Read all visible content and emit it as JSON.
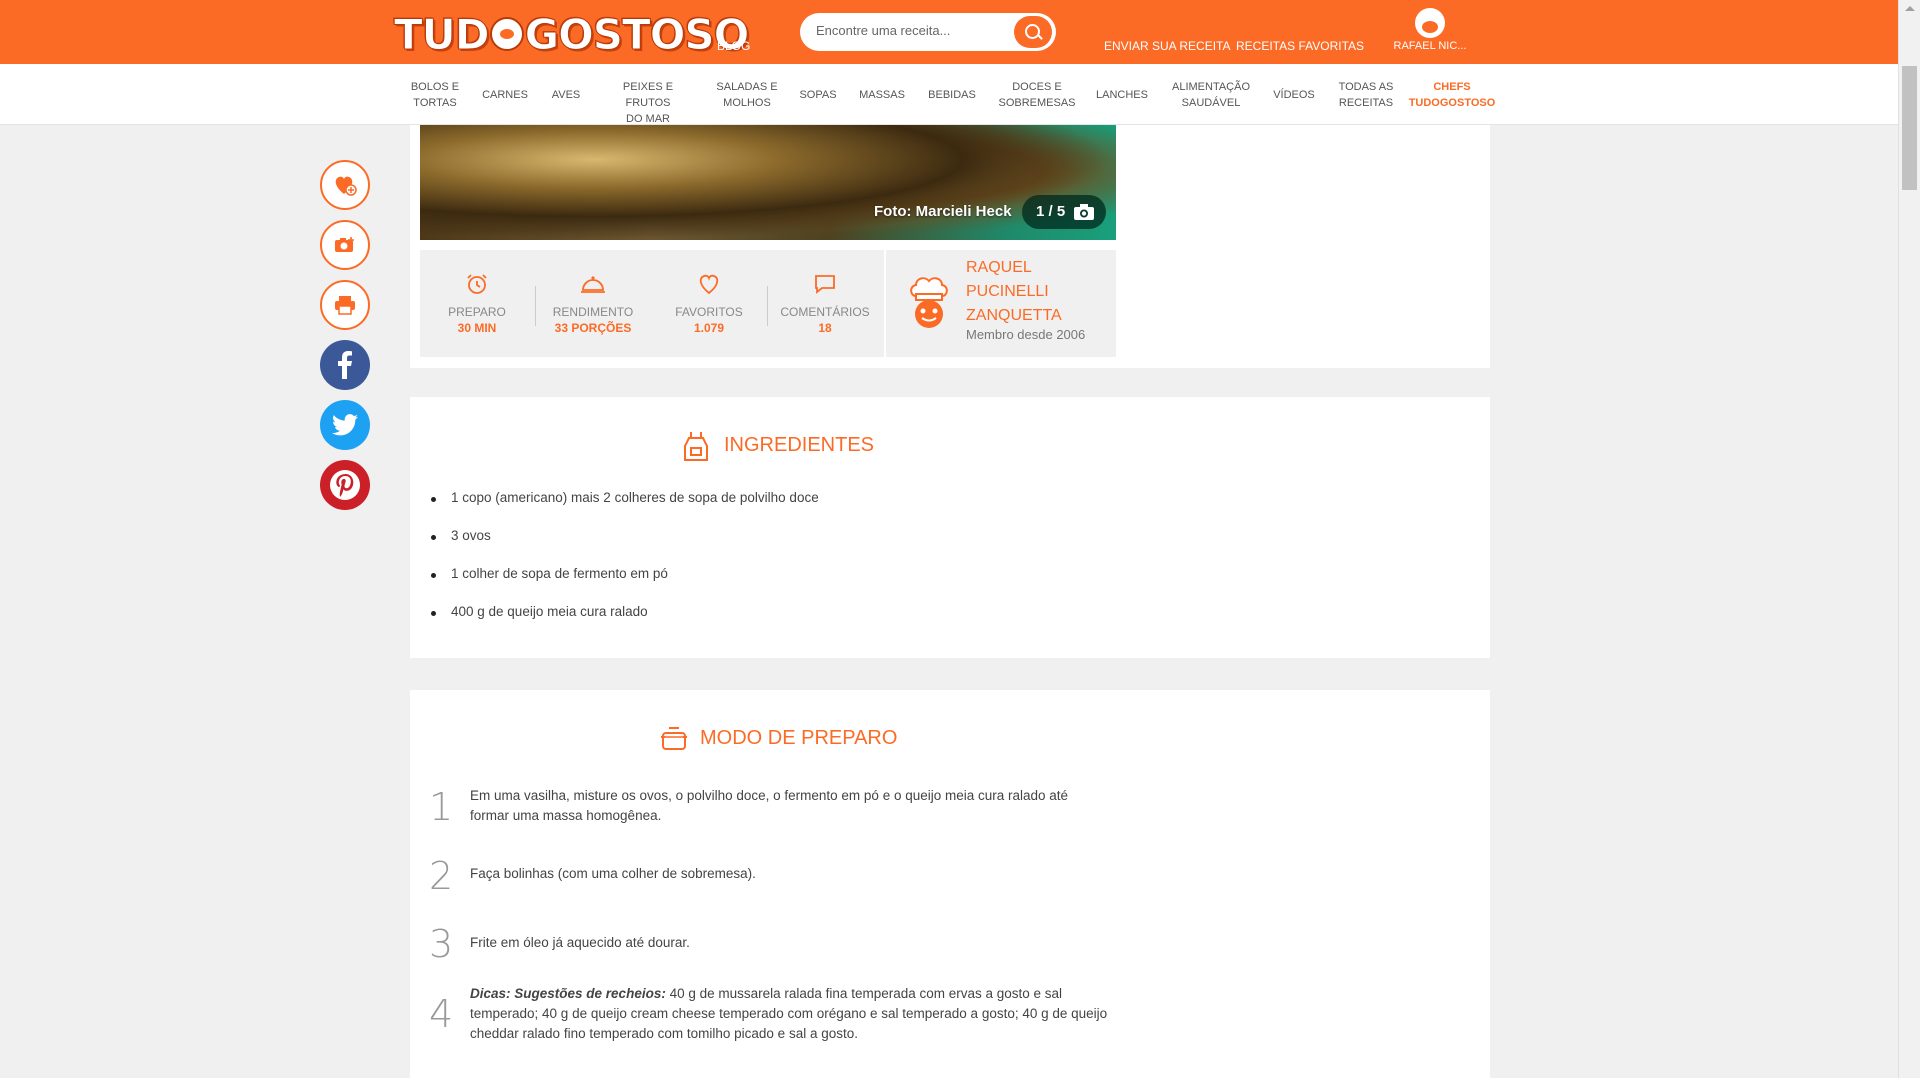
{
  "header": {
    "logo_text": "TUDOGOSTOSO",
    "blog_label": "BLOG",
    "search_placeholder": "Encontre uma receita...",
    "send_recipe": "ENVIAR SUA RECEITA",
    "favorites": "RECEITAS FAVORITAS",
    "user_name": "RAFAEL NIC..."
  },
  "categories": [
    {
      "label1": "BOLOS E",
      "label2": "TORTAS"
    },
    {
      "label1": "CARNES",
      "label2": ""
    },
    {
      "label1": "AVES",
      "label2": ""
    },
    {
      "label1": "PEIXES E FRUTOS",
      "label2": "DO MAR"
    },
    {
      "label1": "SALADAS E",
      "label2": "MOLHOS"
    },
    {
      "label1": "SOPAS",
      "label2": ""
    },
    {
      "label1": "MASSAS",
      "label2": ""
    },
    {
      "label1": "BEBIDAS",
      "label2": ""
    },
    {
      "label1": "DOCES E",
      "label2": "SOBREMESAS"
    },
    {
      "label1": "LANCHES",
      "label2": ""
    },
    {
      "label1": "ALIMENTAÇÃO",
      "label2": "SAUDÁVEL"
    },
    {
      "label1": "VÍDEOS",
      "label2": ""
    },
    {
      "label1": "TODAS AS",
      "label2": "RECEITAS"
    },
    {
      "label1": "CHEFS",
      "label2": "TUDOGOSTOSO"
    }
  ],
  "photo": {
    "credit": "Foto: Marcieli Heck",
    "counter": "1 / 5"
  },
  "stats": {
    "preparo_label": "PREPARO",
    "preparo_value": "30 MIN",
    "rendimento_label": "RENDIMENTO",
    "rendimento_value": "33 PORÇÕES",
    "favoritos_label": "FAVORITOS",
    "favoritos_value": "1.079",
    "comentarios_label": "COMENTÁRIOS",
    "comentarios_value": "18"
  },
  "author": {
    "name": "RAQUEL PUCINELLI ZANQUETTA",
    "since": "Membro desde 2006"
  },
  "ingredients": {
    "title": "INGREDIENTES",
    "items": [
      "1 copo (americano) mais 2 colheres de sopa de polvilho doce",
      "3 ovos",
      "1 colher de sopa de fermento em pó",
      "400 g de queijo meia cura ralado"
    ]
  },
  "preparation": {
    "title": "MODO DE PREPARO",
    "steps": [
      {
        "num": "1",
        "text": "Em uma vasilha, misture os ovos, o polvilho doce, o fermento em pó e o queijo meia cura ralado até formar uma massa homogênea."
      },
      {
        "num": "2",
        "text": "Faça bolinhas (com uma colher de sobremesa)."
      },
      {
        "num": "3",
        "text": "Frite em óleo já aquecido até dourar."
      },
      {
        "num": "4",
        "tip_label": "Dicas: Sugestões de recheios:",
        "text": " 40 g de mussarela ralada fina temperada com ervas a gosto e sal temperado; 40 g de queijo cream cheese temperado com orégano e sal temperado a gosto; 40 g de queijo cheddar ralado fino temperado com tomilho picado e sal a gosto."
      }
    ]
  },
  "colors": {
    "brand": "#fc6b26",
    "facebook": "#3b5998",
    "twitter": "#1da1f2",
    "pinterest": "#cb2027"
  }
}
